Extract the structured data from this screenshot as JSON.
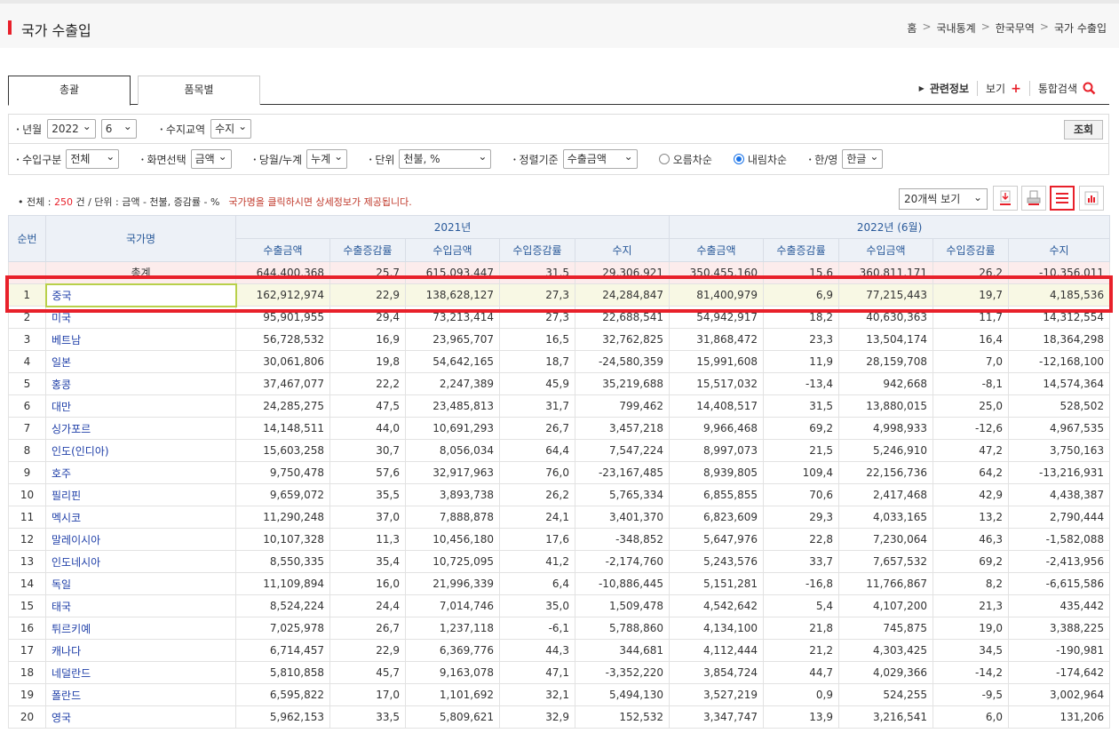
{
  "header": {
    "title": "국가 수출입",
    "breadcrumb": [
      "홈",
      "국내통계",
      "한국무역",
      "국가 수출입"
    ]
  },
  "tabs": [
    {
      "label": "총괄",
      "active": true
    },
    {
      "label": "품목별",
      "active": false
    }
  ],
  "rightlinks": {
    "related": "관련정보",
    "view": "보기",
    "search": "통합검색"
  },
  "filters": {
    "year_month_label": "년월",
    "year": "2022",
    "month": "6",
    "trade_label": "수지교역",
    "trade": "수지",
    "search_button": "조회",
    "import_type_label": "수입구분",
    "import_type": "전체",
    "screen_label": "화면선택",
    "screen": "금액",
    "period_label": "당월/누계",
    "period": "누계",
    "unit_label": "단위",
    "unit": "천불, %",
    "sort_label": "정렬기준",
    "sort": "수출금액",
    "asc_label": "오름차순",
    "desc_label": "내림차순",
    "lang_label": "한/영",
    "lang": "한글"
  },
  "summary": {
    "prefix": "전체 : ",
    "count": "250",
    "suffix": " 건 / 단위 : 금액 - 천불, 증감률 - %",
    "note": "국가명을 클릭하시면 상세정보가 제공됩니다."
  },
  "view_select": "20개씩 보기",
  "table": {
    "col_rank": "순번",
    "col_country": "국가명",
    "group1": "2021년",
    "group2": "2022년 (6월)",
    "sub": [
      "수출금액",
      "수출증감률",
      "수입금액",
      "수입증감률",
      "수지"
    ],
    "total": {
      "label": "총계",
      "vals": [
        "644,400,368",
        "25,7",
        "615,093,447",
        "31,5",
        "29,306,921",
        "350,455,160",
        "15,6",
        "360,811,171",
        "26,2",
        "-10,356,011"
      ]
    },
    "rows": [
      {
        "rank": "1",
        "name": "중국",
        "vals": [
          "162,912,974",
          "22,9",
          "138,628,127",
          "27,3",
          "24,284,847",
          "81,400,979",
          "6,9",
          "77,215,443",
          "19,7",
          "4,185,536"
        ]
      },
      {
        "rank": "2",
        "name": "미국",
        "vals": [
          "95,901,955",
          "29,4",
          "73,213,414",
          "27,3",
          "22,688,541",
          "54,942,917",
          "18,2",
          "40,630,363",
          "11,7",
          "14,312,554"
        ]
      },
      {
        "rank": "3",
        "name": "베트남",
        "vals": [
          "56,728,532",
          "16,9",
          "23,965,707",
          "16,5",
          "32,762,825",
          "31,868,472",
          "23,3",
          "13,504,174",
          "16,4",
          "18,364,298"
        ]
      },
      {
        "rank": "4",
        "name": "일본",
        "vals": [
          "30,061,806",
          "19,8",
          "54,642,165",
          "18,7",
          "-24,580,359",
          "15,991,608",
          "11,9",
          "28,159,708",
          "7,0",
          "-12,168,100"
        ]
      },
      {
        "rank": "5",
        "name": "홍콩",
        "vals": [
          "37,467,077",
          "22,2",
          "2,247,389",
          "45,9",
          "35,219,688",
          "15,517,032",
          "-13,4",
          "942,668",
          "-8,1",
          "14,574,364"
        ]
      },
      {
        "rank": "6",
        "name": "대만",
        "vals": [
          "24,285,275",
          "47,5",
          "23,485,813",
          "31,7",
          "799,462",
          "14,408,517",
          "31,5",
          "13,880,015",
          "25,0",
          "528,502"
        ]
      },
      {
        "rank": "7",
        "name": "싱가포르",
        "vals": [
          "14,148,511",
          "44,0",
          "10,691,293",
          "26,7",
          "3,457,218",
          "9,966,468",
          "69,2",
          "4,998,933",
          "-12,6",
          "4,967,535"
        ]
      },
      {
        "rank": "8",
        "name": "인도(인디아)",
        "vals": [
          "15,603,258",
          "30,7",
          "8,056,034",
          "64,4",
          "7,547,224",
          "8,997,073",
          "21,5",
          "5,246,910",
          "47,2",
          "3,750,163"
        ]
      },
      {
        "rank": "9",
        "name": "호주",
        "vals": [
          "9,750,478",
          "57,6",
          "32,917,963",
          "76,0",
          "-23,167,485",
          "8,939,805",
          "109,4",
          "22,156,736",
          "64,2",
          "-13,216,931"
        ]
      },
      {
        "rank": "10",
        "name": "필리핀",
        "vals": [
          "9,659,072",
          "35,5",
          "3,893,738",
          "26,2",
          "5,765,334",
          "6,855,855",
          "70,6",
          "2,417,468",
          "42,9",
          "4,438,387"
        ]
      },
      {
        "rank": "11",
        "name": "멕시코",
        "vals": [
          "11,290,248",
          "37,0",
          "7,888,878",
          "24,1",
          "3,401,370",
          "6,823,609",
          "29,3",
          "4,033,165",
          "13,2",
          "2,790,444"
        ]
      },
      {
        "rank": "12",
        "name": "말레이시아",
        "vals": [
          "10,107,328",
          "11,3",
          "10,456,180",
          "17,6",
          "-348,852",
          "5,647,976",
          "22,8",
          "7,230,064",
          "46,3",
          "-1,582,088"
        ]
      },
      {
        "rank": "13",
        "name": "인도네시아",
        "vals": [
          "8,550,335",
          "35,4",
          "10,725,095",
          "41,2",
          "-2,174,760",
          "5,243,576",
          "33,7",
          "7,657,532",
          "69,2",
          "-2,413,956"
        ]
      },
      {
        "rank": "14",
        "name": "독일",
        "vals": [
          "11,109,894",
          "16,0",
          "21,996,339",
          "6,4",
          "-10,886,445",
          "5,151,281",
          "-16,8",
          "11,766,867",
          "8,2",
          "-6,615,586"
        ]
      },
      {
        "rank": "15",
        "name": "태국",
        "vals": [
          "8,524,224",
          "24,4",
          "7,014,746",
          "35,0",
          "1,509,478",
          "4,542,642",
          "5,4",
          "4,107,200",
          "21,3",
          "435,442"
        ]
      },
      {
        "rank": "16",
        "name": "튀르키예",
        "vals": [
          "7,025,978",
          "26,7",
          "1,237,118",
          "-6,1",
          "5,788,860",
          "4,134,100",
          "21,8",
          "745,875",
          "19,0",
          "3,388,225"
        ]
      },
      {
        "rank": "17",
        "name": "캐나다",
        "vals": [
          "6,714,457",
          "22,9",
          "6,369,776",
          "44,3",
          "344,681",
          "4,112,444",
          "21,2",
          "4,303,425",
          "34,5",
          "-190,981"
        ]
      },
      {
        "rank": "18",
        "name": "네덜란드",
        "vals": [
          "5,810,858",
          "45,7",
          "9,163,078",
          "47,1",
          "-3,352,220",
          "3,854,724",
          "44,7",
          "4,029,366",
          "-14,2",
          "-174,642"
        ]
      },
      {
        "rank": "19",
        "name": "폴란드",
        "vals": [
          "6,595,822",
          "17,0",
          "1,101,692",
          "32,1",
          "5,494,130",
          "3,527,219",
          "0,9",
          "524,255",
          "-9,5",
          "3,002,964"
        ]
      },
      {
        "rank": "20",
        "name": "영국",
        "vals": [
          "5,962,153",
          "33,5",
          "5,809,621",
          "32,9",
          "152,532",
          "3,347,747",
          "13,9",
          "3,216,541",
          "6,0",
          "131,206"
        ]
      }
    ]
  }
}
